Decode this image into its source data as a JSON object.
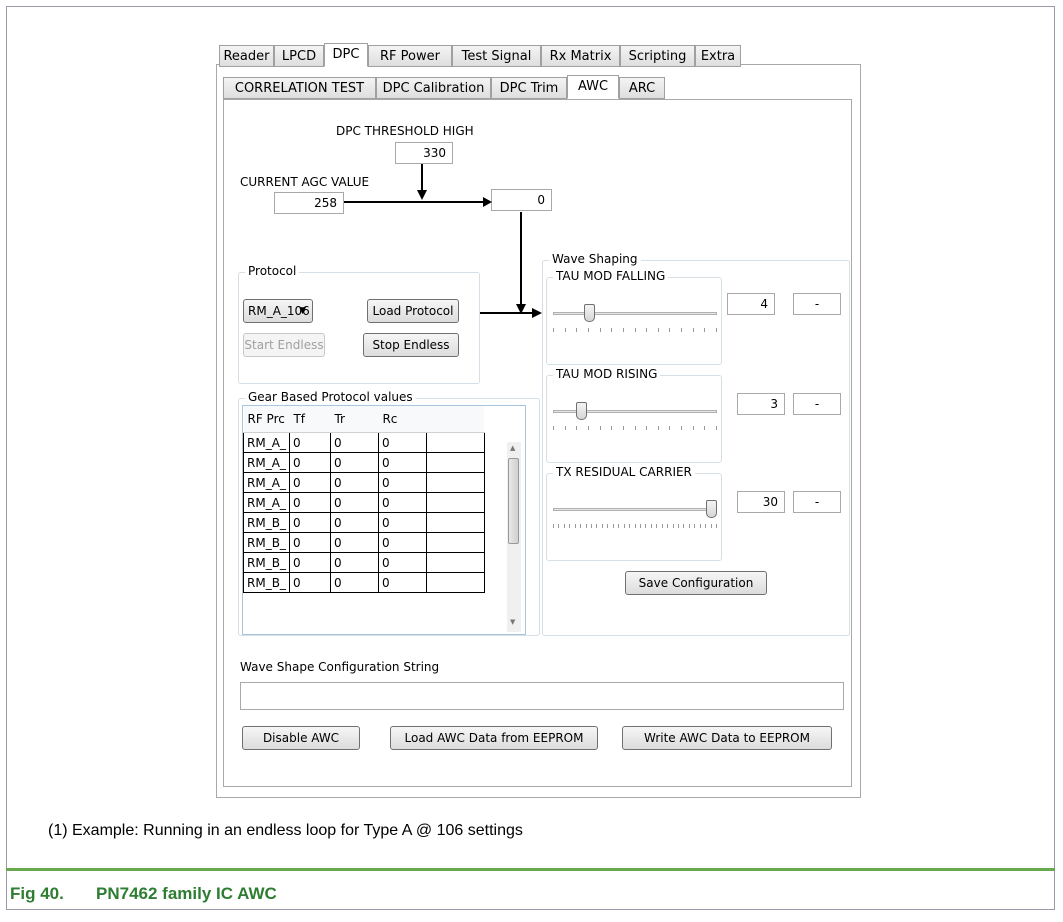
{
  "main_tabs": [
    "Reader",
    "LPCD",
    "DPC",
    "RF Power",
    "Test Signal",
    "Rx Matrix",
    "Scripting",
    "Extra"
  ],
  "sub_tabs": [
    "CORRELATION TEST",
    "DPC Calibration",
    "DPC Trim",
    "AWC",
    "ARC"
  ],
  "dpc": {
    "threshold_label": "DPC THRESHOLD HIGH",
    "threshold_value": "330",
    "agc_label": "CURRENT AGC VALUE",
    "agc_value": "258",
    "result_value": "0"
  },
  "protocol": {
    "legend": "Protocol",
    "selected": "RM_A_106",
    "load_label": "Load Protocol",
    "start_label": "Start Endless",
    "stop_label": "Stop Endless"
  },
  "gear": {
    "legend": "Gear Based Protocol values",
    "columns": [
      "RF Prc",
      "Tf",
      "Tr",
      "Rc"
    ],
    "rows": [
      [
        "RM_A_",
        "0",
        "0",
        "0"
      ],
      [
        "RM_A_",
        "0",
        "0",
        "0"
      ],
      [
        "RM_A_",
        "0",
        "0",
        "0"
      ],
      [
        "RM_A_",
        "0",
        "0",
        "0"
      ],
      [
        "RM_B_",
        "0",
        "0",
        "0"
      ],
      [
        "RM_B_",
        "0",
        "0",
        "0"
      ],
      [
        "RM_B_",
        "0",
        "0",
        "0"
      ],
      [
        "RM_B_",
        "0",
        "0",
        "0"
      ]
    ]
  },
  "wave": {
    "legend": "Wave Shaping",
    "sliders": [
      {
        "label": "TAU MOD FALLING",
        "value": "4",
        "extra": "-",
        "level": 0.2
      },
      {
        "label": "TAU MOD RISING",
        "value": "3",
        "extra": "-",
        "level": 0.15
      },
      {
        "label": "TX RESIDUAL CARRIER",
        "value": "30",
        "extra": "-",
        "level": 1.0
      }
    ],
    "save_label": "Save Configuration"
  },
  "config": {
    "label": "Wave Shape Configuration String",
    "value": ""
  },
  "buttons": {
    "disable": "Disable AWC",
    "load_eeprom": "Load AWC Data from EEPROM",
    "write_eeprom": "Write AWC Data to EEPROM"
  },
  "caption": {
    "note": "(1)   Example: Running in an endless loop for Type A  @ 106 settings",
    "fig_number": "Fig 40.",
    "fig_title": "PN7462 family IC AWC"
  }
}
